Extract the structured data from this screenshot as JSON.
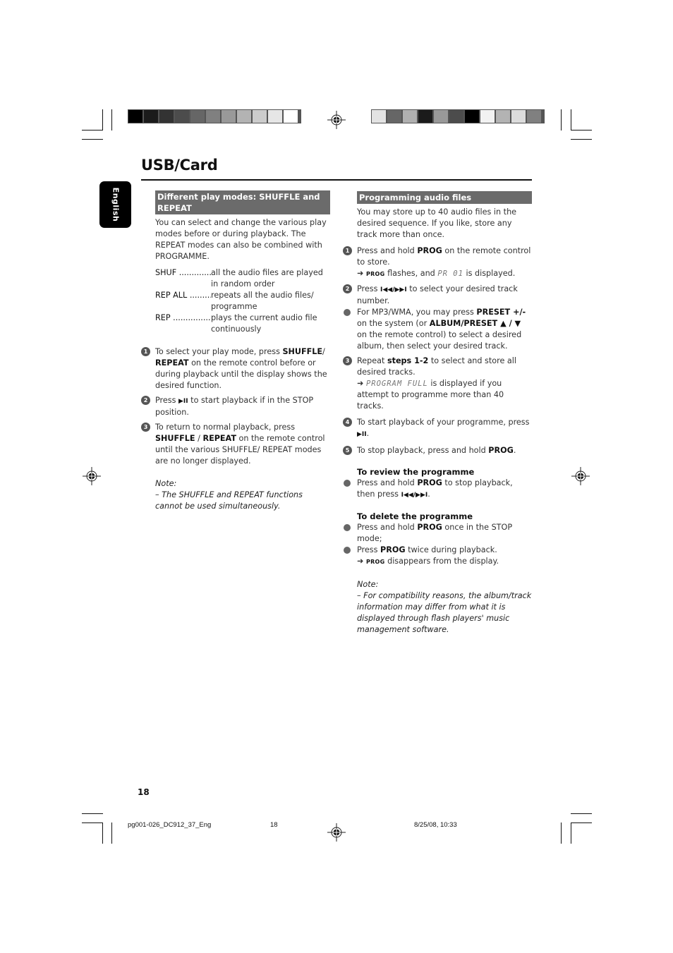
{
  "page": {
    "title": "USB/Card",
    "language_tab": "English",
    "page_number": "18"
  },
  "print_marks": {
    "left_strip_colors": [
      "#000000",
      "#1b1b1b",
      "#333333",
      "#4c4c4c",
      "#666666",
      "#808080",
      "#999999",
      "#b3b3b3",
      "#cccccc",
      "#e6e6e6",
      "#ffffff"
    ],
    "right_strip_colors": [
      "#e3e3e3",
      "#666666",
      "#b0b0b0",
      "#1b1b1b",
      "#999999",
      "#4c4c4c",
      "#000000",
      "#f2f2f2",
      "#b3b3b3",
      "#dcdcdc",
      "#808080"
    ]
  },
  "left_column": {
    "heading": "Different play modes: SHUFFLE and REPEAT",
    "intro": "You can select and change the various play modes before or during playback. The REPEAT modes can also be combined with PROGRAMME.",
    "modes": [
      {
        "term": "SHUF ................................",
        "desc": "all the audio files are played in random order"
      },
      {
        "term": "REP ALL ..........................",
        "desc": "repeats all the audio files/ programme"
      },
      {
        "term": "REP ....................................",
        "desc": "plays the current audio file continuously"
      }
    ],
    "steps": [
      {
        "num": "1",
        "pre": "To select your play mode, press ",
        "bold1": "SHUFFLE",
        "mid": "/ ",
        "bold2": "REPEAT",
        "post": " on the remote control before or during playback until the display shows the desired function."
      },
      {
        "num": "2",
        "pre": "Press ",
        "icon": "▶II",
        "post": " to start playback if in the STOP position."
      },
      {
        "num": "3",
        "pre": "To return to normal playback, press ",
        "bold1": "SHUFFLE",
        "mid": " / ",
        "bold2": "REPEAT",
        "post": " on the remote control until the various SHUFFLE/ REPEAT modes are no longer displayed."
      }
    ],
    "note_label": "Note:",
    "note_text": "– The SHUFFLE and REPEAT functions cannot be used simultaneously."
  },
  "right_column": {
    "heading": "Programming audio files",
    "intro": "You may store up to 40 audio files in the desired sequence. If you like, store any track more than once.",
    "step1": {
      "num": "1",
      "pre": "Press and hold ",
      "bold": "PROG",
      "post": " on the remote control to store.",
      "result_arrow": "➜",
      "result_sc": "PROG",
      "result_mid": " flashes, and ",
      "result_lcd": "PR 01",
      "result_post": " is displayed."
    },
    "step2": {
      "num": "2",
      "pre": "Press ",
      "icon": "I◀◀/▶▶I",
      "post": " to select your desired track number."
    },
    "bullet_mp3": {
      "pre": "For MP3/WMA, you may press ",
      "bold1": "PRESET +/-",
      "mid": " on the system (or ",
      "bold2": "ALBUM/PRESET ▲ / ▼",
      "post": " on the remote control) to select a desired album, then select your desired track."
    },
    "step3": {
      "num": "3",
      "pre": "Repeat ",
      "bold": "steps 1-2",
      "post": " to select and store all desired tracks.",
      "result_arrow": "➜",
      "result_lcd": "PROGRAM FULL",
      "result_post": " is displayed if you attempt to programme more than 40 tracks."
    },
    "step4": {
      "num": "4",
      "pre": "To start playback of your programme, press ",
      "icon": "▶II",
      "post": "."
    },
    "step5": {
      "num": "5",
      "pre": "To stop playback, press and hold ",
      "bold": "PROG",
      "post": "."
    },
    "review": {
      "heading": "To review the programme",
      "pre": "Press and hold ",
      "bold": "PROG",
      "mid": " to stop playback, then press ",
      "icon": "I◀◀/▶▶I",
      "post": "."
    },
    "delete": {
      "heading": "To delete the programme",
      "b1_pre": "Press and hold ",
      "b1_bold": "PROG",
      "b1_post": " once in the STOP mode;",
      "b2_pre": "Press ",
      "b2_bold": "PROG",
      "b2_post": " twice during playback.",
      "result_arrow": "➜",
      "result_sc": "PROG",
      "result_post": " disappears from the display."
    },
    "note_label": "Note:",
    "note_text": "–  For compatibility reasons, the album/track information may differ from what it is displayed through flash players' music management software."
  },
  "footer": {
    "file": "pg001-026_DC912_37_Eng",
    "page": "18",
    "timestamp": "8/25/08, 10:33"
  }
}
